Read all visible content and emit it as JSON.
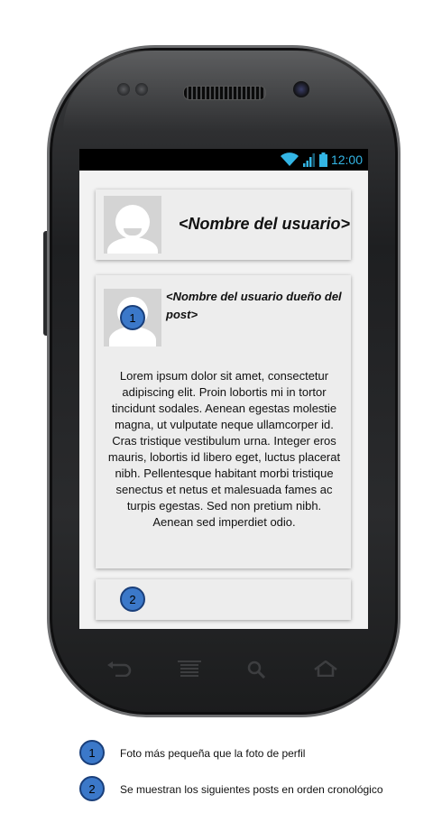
{
  "status_bar": {
    "time": "12:00",
    "wifi_icon": "wifi-icon",
    "signal_icon": "signal-icon",
    "battery_icon": "battery-icon"
  },
  "profile_card": {
    "name": "<Nombre del usuario>",
    "avatar_icon": "user-avatar-icon"
  },
  "post_card": {
    "owner": "<Nombre del usuario dueño del post>",
    "avatar_icon": "user-avatar-icon",
    "body": "Lorem ipsum dolor sit amet, consectetur adipiscing elit. Proin lobortis mi in tortor tincidunt sodales. Aenean egestas molestie magna, ut vulputate neque ullamcorper id. Cras tristique vestibulum urna. Integer eros mauris, lobortis id libero eget, luctus placerat nibh. Pellentesque habitant morbi tristique senectus et netus et malesuada fames ac turpis egestas. Sed non pretium nibh. Aenean sed imperdiet odio."
  },
  "markers": {
    "one": "1",
    "two": "2"
  },
  "nav_bar": [
    "back-icon",
    "menu-icon",
    "search-icon",
    "home-icon"
  ],
  "legend": [
    {
      "number": "1",
      "text": "Foto más pequeña que la foto de perfil"
    },
    {
      "number": "2",
      "text": "Se muestran los siguientes posts en orden cronológico"
    }
  ]
}
